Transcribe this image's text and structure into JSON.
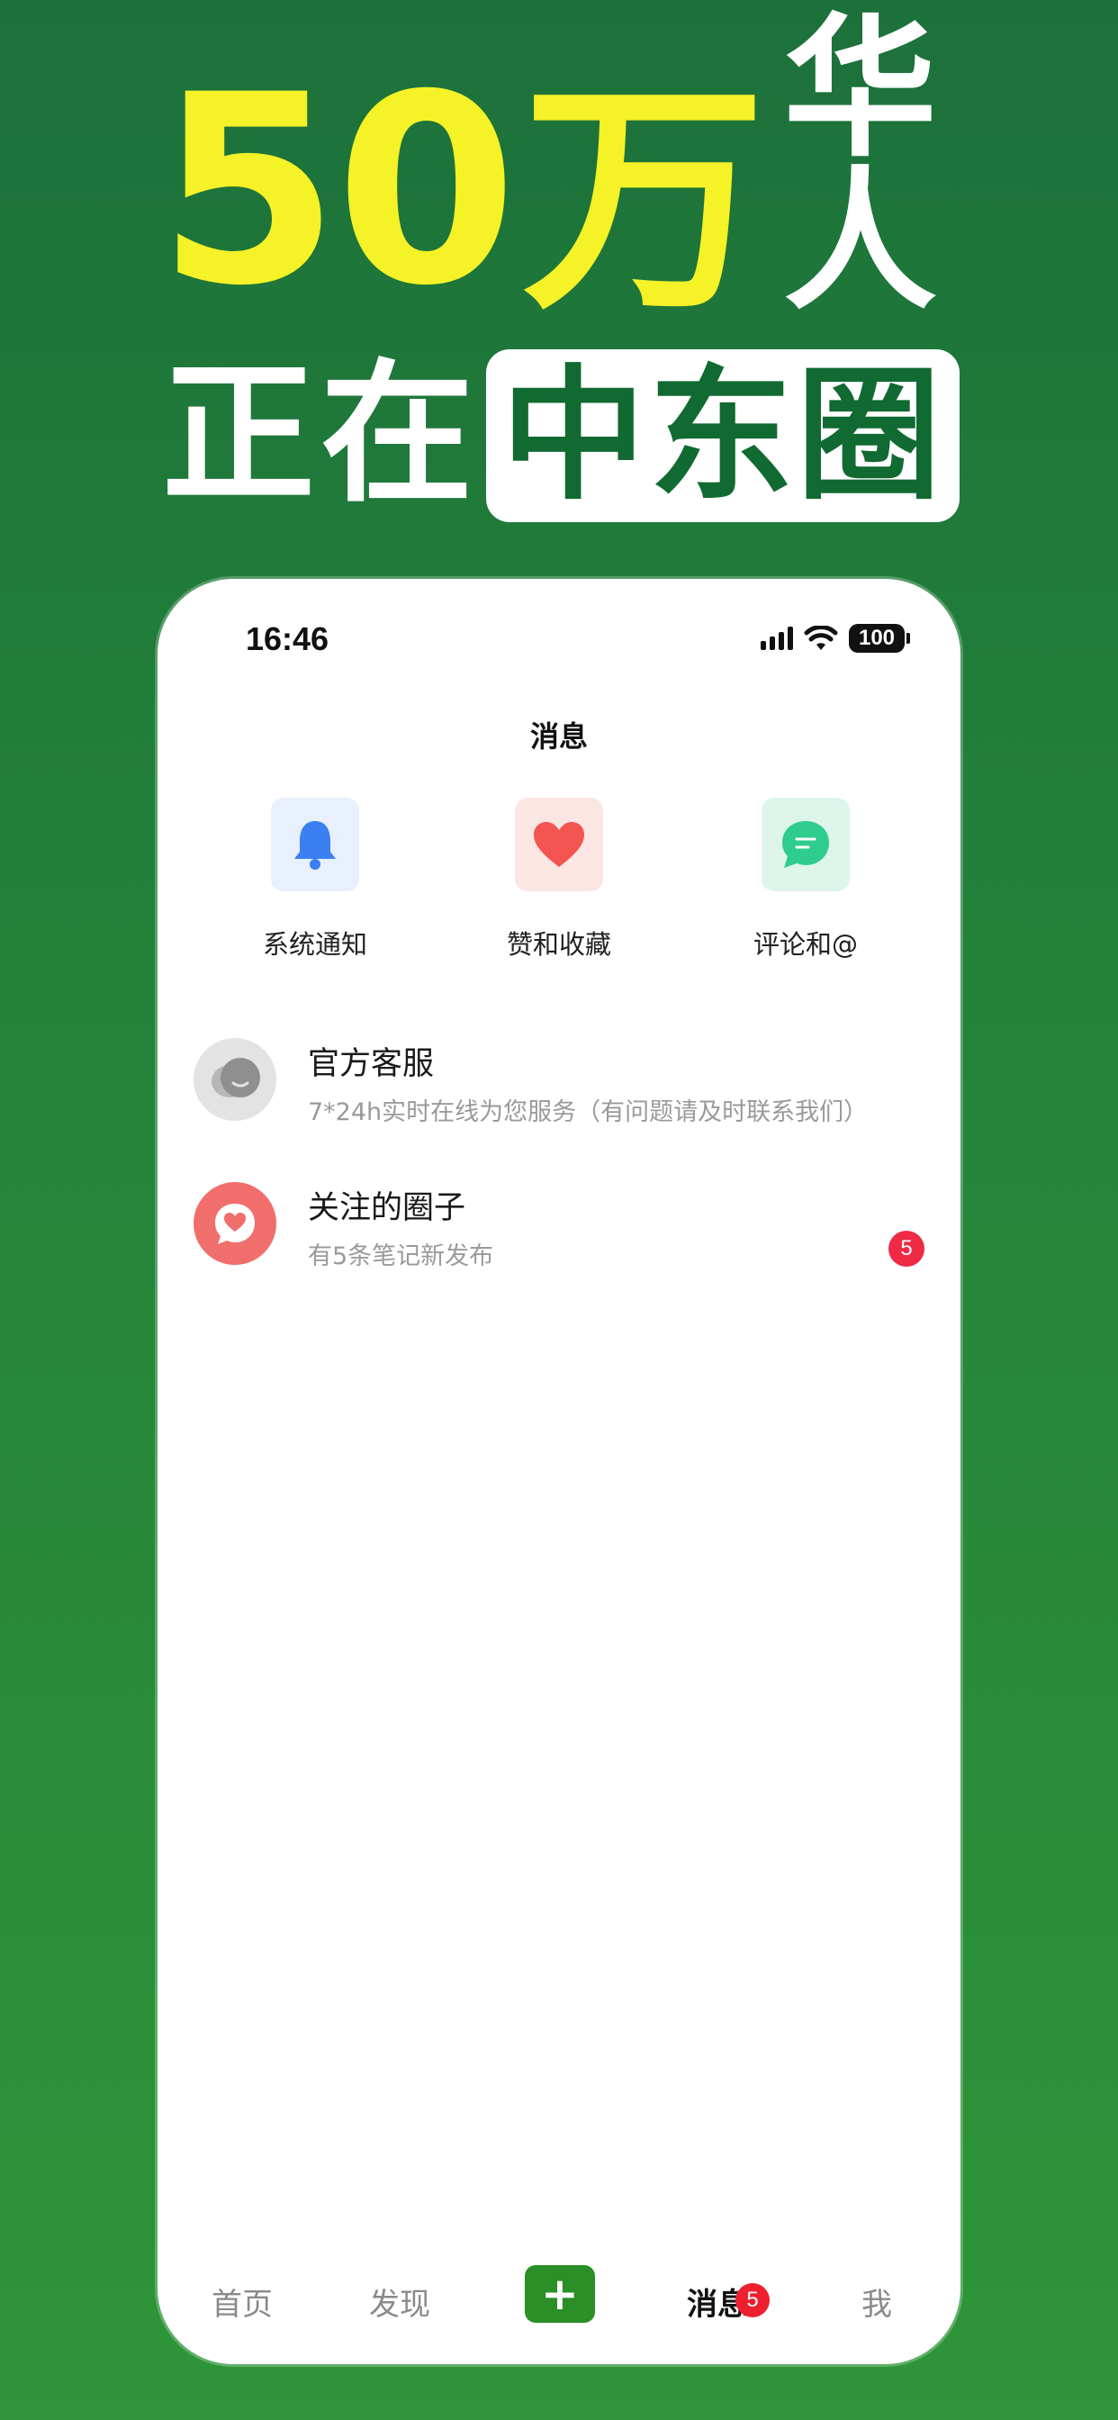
{
  "hero": {
    "number": "50",
    "wan": "万",
    "people": "华人",
    "doing": "正在",
    "brand": "中东圈"
  },
  "status_bar": {
    "time": "16:46",
    "battery": "100"
  },
  "page": {
    "title": "消息"
  },
  "quick_actions": [
    {
      "label": "系统通知",
      "icon": "bell-icon",
      "bg": "#e8f0fd",
      "color": "#3b7ff2"
    },
    {
      "label": "赞和收藏",
      "icon": "heart-icon",
      "bg": "#fbe6e3",
      "color": "#f2544f"
    },
    {
      "label": "评论和@",
      "icon": "chat-bubble-icon",
      "bg": "#def5ec",
      "color": "#2ecc8f"
    }
  ],
  "messages": [
    {
      "title": "官方客服",
      "subtitle": "7*24h实时在线为您服务（有问题请及时联系我们）",
      "avatar_icon": "customer-service-icon",
      "avatar_bg": "#e3e3e3"
    },
    {
      "title": "关注的圈子",
      "subtitle": "有5条笔记新发布",
      "avatar_icon": "heart-chat-icon",
      "avatar_bg": "#f06e6c",
      "badge": "5"
    }
  ],
  "tabbar": {
    "home": "首页",
    "discover": "发现",
    "plus": "+",
    "messages": "消息",
    "messages_badge": "5",
    "me": "我"
  },
  "colors": {
    "background": "#23823a",
    "hero_yellow": "#f5f227",
    "brand_green": "#116a31",
    "accent_green": "#2a8f27",
    "badge_red": "#ee2a45"
  }
}
